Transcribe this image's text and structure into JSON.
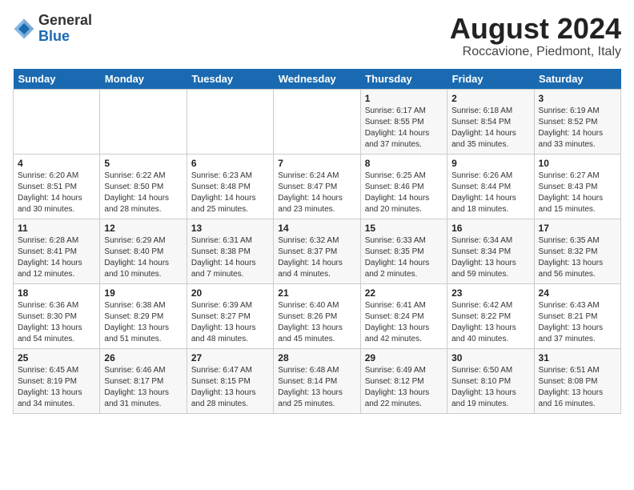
{
  "header": {
    "logo_general": "General",
    "logo_blue": "Blue",
    "month_title": "August 2024",
    "location": "Roccavione, Piedmont, Italy"
  },
  "days_of_week": [
    "Sunday",
    "Monday",
    "Tuesday",
    "Wednesday",
    "Thursday",
    "Friday",
    "Saturday"
  ],
  "weeks": [
    [
      {
        "day": "",
        "info": ""
      },
      {
        "day": "",
        "info": ""
      },
      {
        "day": "",
        "info": ""
      },
      {
        "day": "",
        "info": ""
      },
      {
        "day": "1",
        "info": "Sunrise: 6:17 AM\nSunset: 8:55 PM\nDaylight: 14 hours\nand 37 minutes."
      },
      {
        "day": "2",
        "info": "Sunrise: 6:18 AM\nSunset: 8:54 PM\nDaylight: 14 hours\nand 35 minutes."
      },
      {
        "day": "3",
        "info": "Sunrise: 6:19 AM\nSunset: 8:52 PM\nDaylight: 14 hours\nand 33 minutes."
      }
    ],
    [
      {
        "day": "4",
        "info": "Sunrise: 6:20 AM\nSunset: 8:51 PM\nDaylight: 14 hours\nand 30 minutes."
      },
      {
        "day": "5",
        "info": "Sunrise: 6:22 AM\nSunset: 8:50 PM\nDaylight: 14 hours\nand 28 minutes."
      },
      {
        "day": "6",
        "info": "Sunrise: 6:23 AM\nSunset: 8:48 PM\nDaylight: 14 hours\nand 25 minutes."
      },
      {
        "day": "7",
        "info": "Sunrise: 6:24 AM\nSunset: 8:47 PM\nDaylight: 14 hours\nand 23 minutes."
      },
      {
        "day": "8",
        "info": "Sunrise: 6:25 AM\nSunset: 8:46 PM\nDaylight: 14 hours\nand 20 minutes."
      },
      {
        "day": "9",
        "info": "Sunrise: 6:26 AM\nSunset: 8:44 PM\nDaylight: 14 hours\nand 18 minutes."
      },
      {
        "day": "10",
        "info": "Sunrise: 6:27 AM\nSunset: 8:43 PM\nDaylight: 14 hours\nand 15 minutes."
      }
    ],
    [
      {
        "day": "11",
        "info": "Sunrise: 6:28 AM\nSunset: 8:41 PM\nDaylight: 14 hours\nand 12 minutes."
      },
      {
        "day": "12",
        "info": "Sunrise: 6:29 AM\nSunset: 8:40 PM\nDaylight: 14 hours\nand 10 minutes."
      },
      {
        "day": "13",
        "info": "Sunrise: 6:31 AM\nSunset: 8:38 PM\nDaylight: 14 hours\nand 7 minutes."
      },
      {
        "day": "14",
        "info": "Sunrise: 6:32 AM\nSunset: 8:37 PM\nDaylight: 14 hours\nand 4 minutes."
      },
      {
        "day": "15",
        "info": "Sunrise: 6:33 AM\nSunset: 8:35 PM\nDaylight: 14 hours\nand 2 minutes."
      },
      {
        "day": "16",
        "info": "Sunrise: 6:34 AM\nSunset: 8:34 PM\nDaylight: 13 hours\nand 59 minutes."
      },
      {
        "day": "17",
        "info": "Sunrise: 6:35 AM\nSunset: 8:32 PM\nDaylight: 13 hours\nand 56 minutes."
      }
    ],
    [
      {
        "day": "18",
        "info": "Sunrise: 6:36 AM\nSunset: 8:30 PM\nDaylight: 13 hours\nand 54 minutes."
      },
      {
        "day": "19",
        "info": "Sunrise: 6:38 AM\nSunset: 8:29 PM\nDaylight: 13 hours\nand 51 minutes."
      },
      {
        "day": "20",
        "info": "Sunrise: 6:39 AM\nSunset: 8:27 PM\nDaylight: 13 hours\nand 48 minutes."
      },
      {
        "day": "21",
        "info": "Sunrise: 6:40 AM\nSunset: 8:26 PM\nDaylight: 13 hours\nand 45 minutes."
      },
      {
        "day": "22",
        "info": "Sunrise: 6:41 AM\nSunset: 8:24 PM\nDaylight: 13 hours\nand 42 minutes."
      },
      {
        "day": "23",
        "info": "Sunrise: 6:42 AM\nSunset: 8:22 PM\nDaylight: 13 hours\nand 40 minutes."
      },
      {
        "day": "24",
        "info": "Sunrise: 6:43 AM\nSunset: 8:21 PM\nDaylight: 13 hours\nand 37 minutes."
      }
    ],
    [
      {
        "day": "25",
        "info": "Sunrise: 6:45 AM\nSunset: 8:19 PM\nDaylight: 13 hours\nand 34 minutes."
      },
      {
        "day": "26",
        "info": "Sunrise: 6:46 AM\nSunset: 8:17 PM\nDaylight: 13 hours\nand 31 minutes."
      },
      {
        "day": "27",
        "info": "Sunrise: 6:47 AM\nSunset: 8:15 PM\nDaylight: 13 hours\nand 28 minutes."
      },
      {
        "day": "28",
        "info": "Sunrise: 6:48 AM\nSunset: 8:14 PM\nDaylight: 13 hours\nand 25 minutes."
      },
      {
        "day": "29",
        "info": "Sunrise: 6:49 AM\nSunset: 8:12 PM\nDaylight: 13 hours\nand 22 minutes."
      },
      {
        "day": "30",
        "info": "Sunrise: 6:50 AM\nSunset: 8:10 PM\nDaylight: 13 hours\nand 19 minutes."
      },
      {
        "day": "31",
        "info": "Sunrise: 6:51 AM\nSunset: 8:08 PM\nDaylight: 13 hours\nand 16 minutes."
      }
    ]
  ]
}
